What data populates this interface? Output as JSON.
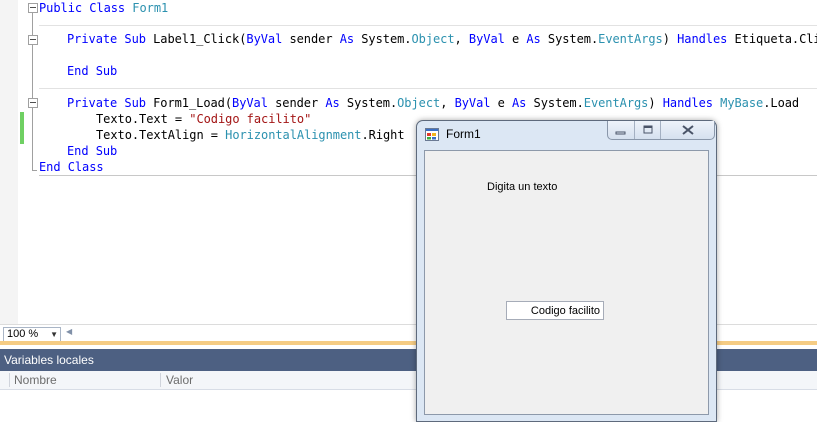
{
  "editor": {
    "lines": {
      "class_open": {
        "kw": "Public Class",
        "name": "Form1"
      },
      "sub1_open": {
        "kw1": "Private Sub",
        "name": "Label1_Click(",
        "byval1": "ByVal",
        "p1": "sender",
        "as1": "As",
        "sys1": "System.",
        "obj": "Object",
        "sep": ",",
        "byval2": "ByVal",
        "p2": "e",
        "as2": "As",
        "sys2": "System.",
        "ea": "EventArgs",
        "paren": ")",
        "handles": "Handles",
        "target": "Etiqueta.Click"
      },
      "sub1_end": {
        "kw": "End Sub"
      },
      "sub2_open": {
        "kw1": "Private Sub",
        "name": "Form1_Load(",
        "byval1": "ByVal",
        "p1": "sender",
        "as1": "As",
        "sys1": "System.",
        "obj": "Object",
        "sep": ",",
        "byval2": "ByVal",
        "p2": "e",
        "as2": "As",
        "sys2": "System.",
        "ea": "EventArgs",
        "paren": ")",
        "handles": "Handles",
        "mybase": "MyBase",
        "load": ".Load"
      },
      "texto_text": {
        "lhs": "Texto.Text = ",
        "value": "\"Codigo facilito\""
      },
      "texto_align": {
        "lhs": "Texto.TextAlign = ",
        "enum": "HorizontalAlignment",
        "member": ".Right"
      },
      "sub2_end": {
        "kw": "End Sub"
      },
      "class_end": {
        "kw": "End Class"
      }
    },
    "colors": {
      "keyword": "#0000ff",
      "type": "#2b91af",
      "string": "#a31515",
      "changed_bar": "#6fd063"
    }
  },
  "zoombar": {
    "zoom": "100 %"
  },
  "locals": {
    "title": "Variables locales",
    "columns": [
      "Nombre",
      "Valor"
    ],
    "header_color": "#4d6082"
  },
  "form1": {
    "title": "Form1",
    "label_text": "Digita un texto",
    "textbox_value": "Codigo facilito",
    "icon": "windows-form-icon",
    "buttons": [
      "minimize-icon",
      "maximize-icon",
      "close-icon"
    ]
  }
}
